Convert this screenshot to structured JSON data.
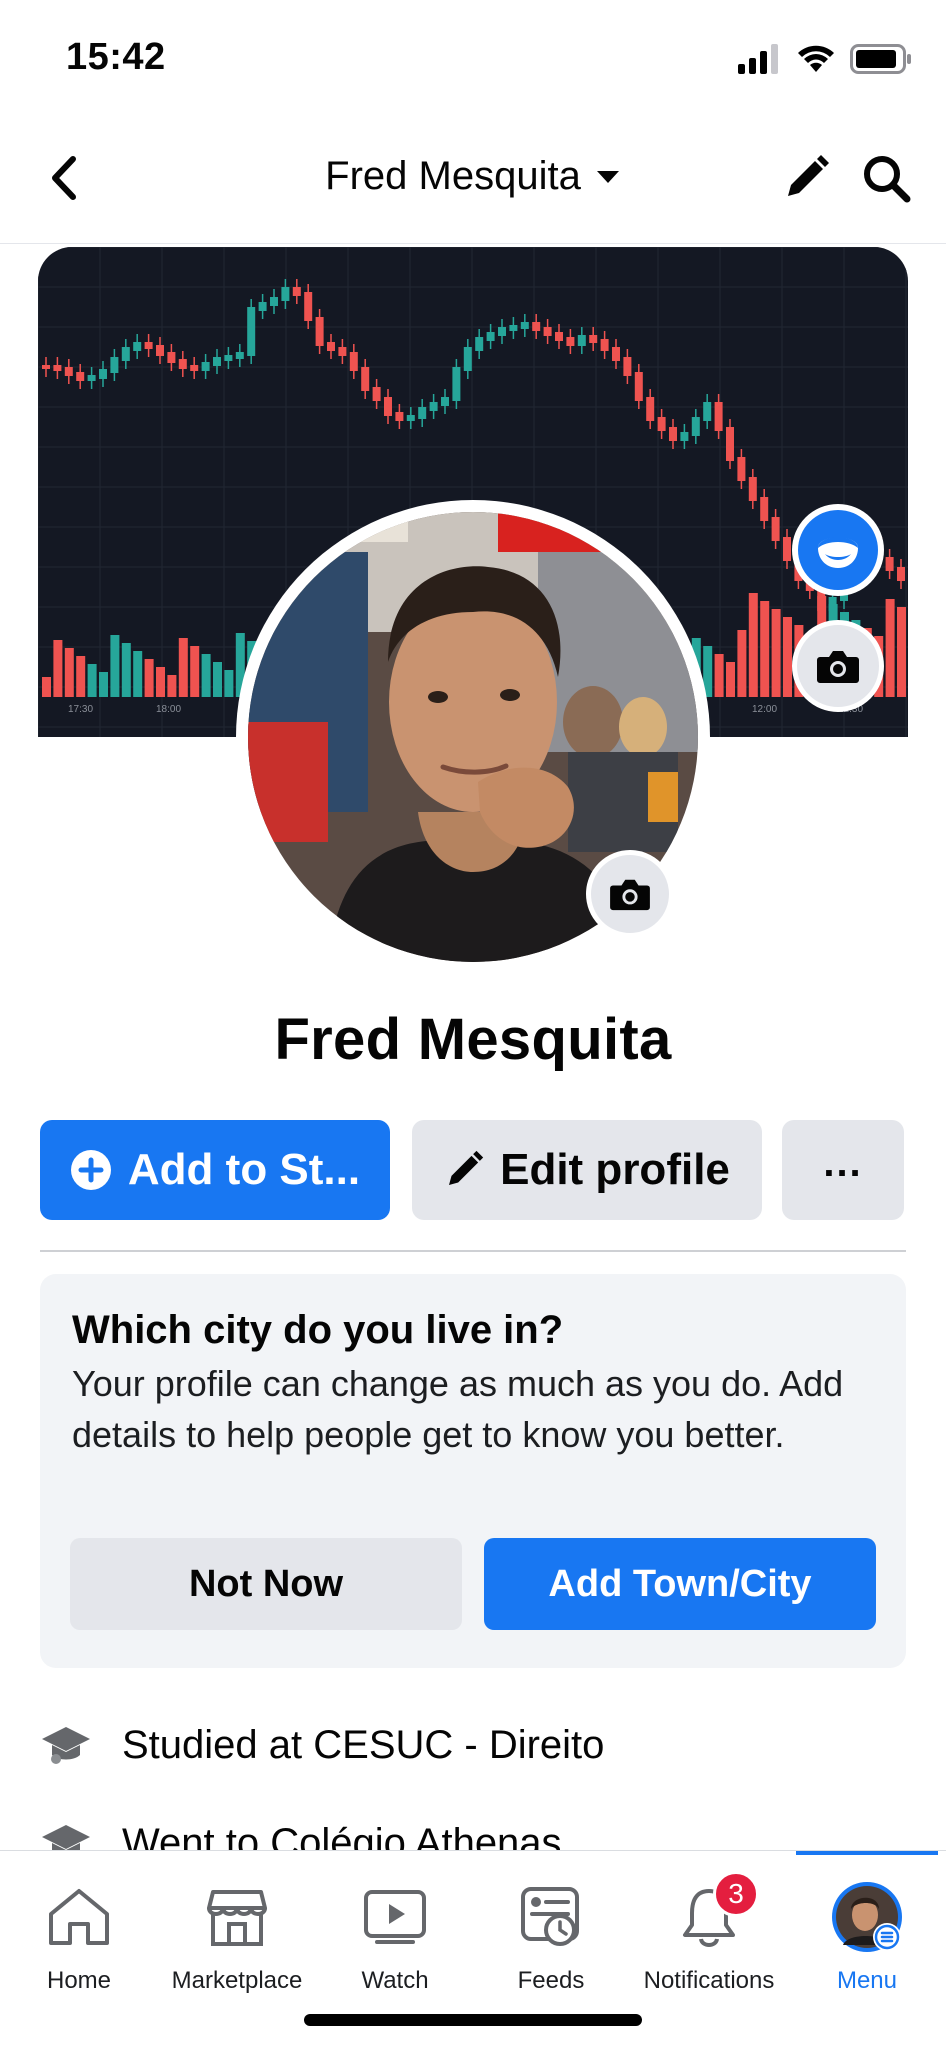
{
  "status_bar": {
    "time": "15:42"
  },
  "header": {
    "title": "Fred Mesquita"
  },
  "cover": {
    "time_labels": [
      "17:30",
      "18:00",
      "12:00",
      "12:30"
    ]
  },
  "profile": {
    "name": "Fred Mesquita",
    "add_story_label": "Add to St...",
    "edit_profile_label": "Edit profile",
    "more_label": "..."
  },
  "prompt_card": {
    "title": "Which city do you live in?",
    "body": "Your profile can change as much as you do. Add details to help people get to know you better.",
    "not_now_label": "Not Now",
    "add_label": "Add Town/City"
  },
  "intro": [
    {
      "icon": "graduation-cap-icon",
      "text": "Studied at CESUC - Direito"
    },
    {
      "icon": "graduation-cap-icon",
      "text": "Went to Colégio Athenas"
    }
  ],
  "tabbar": {
    "items": [
      {
        "label": "Home",
        "icon": "home-icon"
      },
      {
        "label": "Marketplace",
        "icon": "marketplace-icon"
      },
      {
        "label": "Watch",
        "icon": "watch-icon"
      },
      {
        "label": "Feeds",
        "icon": "feeds-icon"
      },
      {
        "label": "Notifications",
        "icon": "bell-icon",
        "badge": "3"
      },
      {
        "label": "Menu",
        "icon": "avatar",
        "active": true
      }
    ]
  },
  "colors": {
    "accent": "#1877f2",
    "badge": "#e41e3f",
    "candle_up": "#26a69a",
    "candle_down": "#ef5350",
    "cover_bg": "#141823"
  }
}
